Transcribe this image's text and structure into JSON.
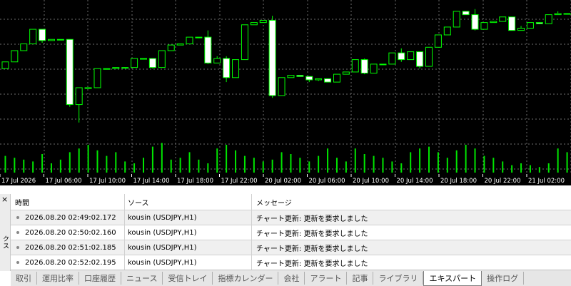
{
  "chart": {
    "bg_color": "#000000",
    "up_color": "#00ff00",
    "grid_color": "#6e6e6e",
    "volume_color": "#00e600",
    "time_labels": [
      "17 Jul 2026",
      "17 Jul 06:00",
      "17 Jul 10:00",
      "17 Jul 14:00",
      "17 Jul 18:00",
      "17 Jul 22:00",
      "20 Jul 02:00",
      "20 Jul 06:00",
      "20 Jul 10:00",
      "20 Jul 14:00",
      "20 Jul 18:00",
      "20 Jul 22:00",
      "21 Jul 02:00"
    ],
    "candles_ohlc_relative": [
      [
        0.56,
        0.5,
        0.6,
        0.46
      ],
      [
        0.5,
        0.4,
        0.52,
        0.38
      ],
      [
        0.4,
        0.34,
        0.43,
        0.32
      ],
      [
        0.34,
        0.21,
        0.37,
        0.18
      ],
      [
        0.21,
        0.31,
        0.24,
        0.33
      ],
      [
        0.31,
        0.3,
        0.32,
        0.28
      ],
      [
        0.3,
        0.3,
        0.32,
        0.28
      ],
      [
        0.3,
        0.88,
        0.33,
        0.9
      ],
      [
        0.88,
        0.73,
        0.88,
        1.04
      ],
      [
        0.73,
        0.73,
        0.73,
        0.73
      ],
      [
        0.73,
        0.56,
        0.79,
        0.55
      ],
      [
        0.56,
        0.56,
        0.58,
        0.5
      ],
      [
        0.56,
        0.55,
        0.56,
        0.55
      ],
      [
        0.55,
        0.55,
        0.56,
        0.55
      ],
      [
        0.55,
        0.47,
        0.6,
        0.44
      ],
      [
        0.47,
        0.47,
        0.47,
        0.47
      ],
      [
        0.47,
        0.55,
        0.5,
        0.56
      ],
      [
        0.55,
        0.4,
        0.56,
        0.38
      ],
      [
        0.4,
        0.35,
        0.46,
        0.32
      ],
      [
        0.35,
        0.34,
        0.38,
        0.34
      ],
      [
        0.34,
        0.28,
        0.3,
        0.26
      ],
      [
        0.28,
        0.28,
        0.3,
        0.26
      ],
      [
        0.28,
        0.51,
        0.22,
        0.52
      ],
      [
        0.51,
        0.47,
        0.45,
        0.5
      ],
      [
        0.47,
        0.64,
        0.45,
        0.68
      ],
      [
        0.64,
        0.48,
        0.64,
        0.58
      ],
      [
        0.48,
        0.17,
        0.18,
        0.0
      ],
      [
        0.17,
        0.15,
        0.18,
        0.13
      ],
      [
        0.15,
        0.13,
        0.17,
        0.13
      ],
      [
        0.13,
        0.8,
        0.09,
        0.82
      ],
      [
        0.8,
        0.64,
        0.81,
        0.63
      ],
      [
        0.64,
        0.62,
        0.66,
        0.59
      ],
      [
        0.62,
        0.63,
        0.63,
        0.62
      ],
      [
        0.63,
        0.66,
        0.63,
        0.68
      ],
      [
        0.66,
        0.65,
        0.66,
        0.67
      ],
      [
        0.65,
        0.68,
        0.67,
        0.64
      ],
      [
        0.68,
        0.61,
        0.68,
        0.61
      ],
      [
        0.61,
        0.59,
        0.62,
        0.58
      ],
      [
        0.59,
        0.48,
        0.61,
        0.47
      ],
      [
        0.48,
        0.6,
        0.47,
        0.61
      ],
      [
        0.6,
        0.52,
        0.6,
        0.5
      ],
      [
        0.52,
        0.52,
        0.53,
        0.51
      ],
      [
        0.52,
        0.42,
        0.52,
        0.41
      ],
      [
        0.42,
        0.48,
        0.38,
        0.5
      ],
      [
        0.48,
        0.41,
        0.48,
        0.42
      ],
      [
        0.41,
        0.54,
        0.5,
        0.56
      ],
      [
        0.54,
        0.37,
        0.56,
        0.34
      ],
      [
        0.37,
        0.26,
        0.39,
        0.25
      ],
      [
        0.26,
        0.19,
        0.26,
        0.17
      ],
      [
        0.19,
        0.05,
        0.17,
        0.04
      ],
      [
        0.05,
        0.08,
        0.05,
        0.08
      ],
      [
        0.08,
        0.21,
        0.03,
        0.22
      ],
      [
        0.21,
        0.15,
        0.21,
        0.14
      ],
      [
        0.15,
        0.14,
        0.15,
        0.14
      ],
      [
        0.14,
        0.1,
        0.14,
        0.09
      ],
      [
        0.1,
        0.22,
        0.1,
        0.22
      ],
      [
        0.22,
        0.2,
        0.18,
        0.21
      ],
      [
        0.2,
        0.15,
        0.19,
        0.13
      ],
      [
        0.15,
        0.16,
        0.16,
        0.16
      ],
      [
        0.16,
        0.08,
        0.16,
        0.06
      ],
      [
        0.08,
        0.07,
        0.05,
        0.08
      ],
      [
        0.07,
        0.07,
        0.07,
        0.07
      ]
    ],
    "volumes_relative": [
      0.45,
      0.4,
      0.35,
      0.3,
      0.5,
      0.25,
      0.35,
      0.55,
      0.65,
      0.75,
      0.6,
      0.45,
      0.55,
      0.3,
      0.25,
      0.4,
      0.7,
      0.8,
      0.35,
      0.4,
      0.55,
      0.35,
      0.25,
      0.65,
      0.75,
      0.6,
      0.45,
      0.4,
      0.3,
      0.35,
      0.55,
      0.5,
      0.4,
      0.3,
      0.45,
      0.65,
      0.4,
      0.3,
      0.65,
      0.5,
      0.45,
      0.4,
      0.3,
      0.25,
      0.55,
      0.65,
      0.7,
      0.55,
      0.4,
      0.6,
      0.75,
      0.65,
      0.45,
      0.4,
      0.3,
      0.2,
      0.25,
      0.2,
      0.15,
      0.25,
      0.65,
      0.55
    ]
  },
  "toolbox": {
    "title": "ツールボックス",
    "close": "×",
    "columns": [
      "時間",
      "ソース",
      "メッセージ"
    ],
    "rows": [
      {
        "time": "2026.08.20 02:49:02.172",
        "source": "kousin (USDJPY,H1)",
        "message": "チャート更新: 更新を要求しました"
      },
      {
        "time": "2026.08.20 02:50:02.160",
        "source": "kousin (USDJPY,H1)",
        "message": "チャート更新: 更新を要求しました"
      },
      {
        "time": "2026.08.20 02:51:02.185",
        "source": "kousin (USDJPY,H1)",
        "message": "チャート更新: 更新を要求しました"
      },
      {
        "time": "2026.08.20 02:52:02.195",
        "source": "kousin (USDJPY,H1)",
        "message": "チャート更新: 更新を要求しました"
      }
    ],
    "tabs": [
      "取引",
      "運用比率",
      "口座履歴",
      "ニュース",
      "受信トレイ",
      "指標カレンダー",
      "会社",
      "アラート",
      "記事",
      "ライブラリ",
      "エキスパート",
      "操作ログ"
    ],
    "active_tab": "エキスパート"
  }
}
